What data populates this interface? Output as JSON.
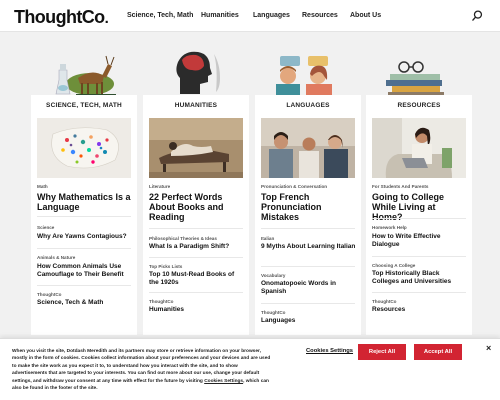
{
  "header": {
    "logo_main": "ThoughtCo",
    "logo_suffix": ".",
    "nav": [
      "Science, Tech, Math",
      "Humanities",
      "Languages",
      "Resources",
      "About Us"
    ],
    "search_icon": "search-icon"
  },
  "cards": [
    {
      "title": "SCIENCE, TECH, MATH",
      "feature_kicker": "Math",
      "feature_headline": "Why Mathematics Is a Language",
      "items": [
        {
          "kicker": "Science",
          "headline": "Why Are Yawns Contagious?"
        },
        {
          "kicker": "Animals & Nature",
          "headline": "How Common Animals Use Camouflage to Their Benefit"
        },
        {
          "kicker": "ThoughtCo",
          "headline": "Science, Tech & Math"
        }
      ]
    },
    {
      "title": "HUMANITIES",
      "feature_kicker": "Literature",
      "feature_headline": "22 Perfect Words About Books and Reading",
      "items": [
        {
          "kicker": "Philosophical Theories & Ideas",
          "headline": "What Is a Paradigm Shift?"
        },
        {
          "kicker": "Top Picks Lists",
          "headline": "Top 10 Must-Read Books of the 1920s"
        },
        {
          "kicker": "ThoughtCo",
          "headline": "Humanities"
        }
      ]
    },
    {
      "title": "LANGUAGES",
      "feature_kicker": "Pronunciation & Conversation",
      "feature_headline": "Top French Pronunciation Mistakes",
      "items": [
        {
          "kicker": "Italian",
          "headline": "9 Myths About Learning Italian"
        },
        {
          "kicker": "Vocabulary",
          "headline": "Onomatopoeic Words in Spanish"
        },
        {
          "kicker": "ThoughtCo",
          "headline": "Languages"
        }
      ]
    },
    {
      "title": "RESOURCES",
      "feature_kicker": "For Students And Parents",
      "feature_headline": "Going to College While Living at Home?",
      "items": [
        {
          "kicker": "Homework Help",
          "headline": "How to Write Effective Dialogue"
        },
        {
          "kicker": "Choosing A College",
          "headline": "Top Historically Black Colleges and Universities"
        },
        {
          "kicker": "ThoughtCo",
          "headline": "Resources"
        }
      ]
    }
  ],
  "cookie": {
    "text_before_link": "When you visit the site, Dotdash Meredith and its partners may store or retrieve information on your browser, mostly in the form of cookies. Cookies collect information about your preferences and your devices and are used to make the site work as you expect it to, to understand how you interact with the site, and to show advertisements that are targeted to your interests. You can find out more about our use, change your default settings, and withdraw your consent at any time with effect for the future by visiting",
    "link_label": "Cookies Settings",
    "text_after_link": ", which can also be found in the footer of the site.",
    "settings_label": "Cookies Settings",
    "reject_label": "Reject All",
    "accept_label": "Accept All",
    "close_symbol": "×"
  },
  "colors": {
    "accent_red": "#d22432",
    "page_background": "#f1f1f1"
  }
}
